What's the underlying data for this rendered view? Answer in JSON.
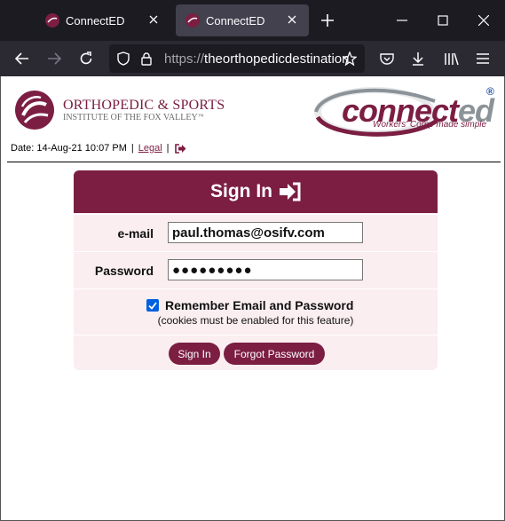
{
  "browser": {
    "tabs": [
      {
        "title": "ConnectED",
        "active": false
      },
      {
        "title": "ConnectED",
        "active": true
      }
    ],
    "url": {
      "protocol": "https://",
      "host": "theorthopedicdestination"
    }
  },
  "header": {
    "osi_name": "ORTHOPEDIC & SPORTS",
    "osi_sub": "INSTITUTE OF THE FOX VALLEY",
    "osi_sub_tm": "™",
    "connected_prefix": "connect",
    "connected_suffix": "ed",
    "connected_tagline": "Workers' Comp made simple",
    "connected_reg": "®"
  },
  "info": {
    "date_label": "Date:",
    "date_value": "14-Aug-21 10:07 PM",
    "separator": "|",
    "legal_link": "Legal"
  },
  "signin": {
    "title": "Sign In",
    "email_label": "e-mail",
    "email_value": "paul.thomas@osifv.com",
    "password_label": "Password",
    "password_value": "●●●●●●●●●",
    "remember_label": "Remember Email and Password",
    "remember_checked": true,
    "cookies_note": "(cookies must be enabled for this feature)",
    "signin_button": "Sign In",
    "forgot_button": "Forgot Password"
  },
  "colors": {
    "brand": "#7b1e42",
    "panel_bg": "#faeef1",
    "chrome_dark": "#1c1b22",
    "chrome_mid": "#2b2a33"
  }
}
